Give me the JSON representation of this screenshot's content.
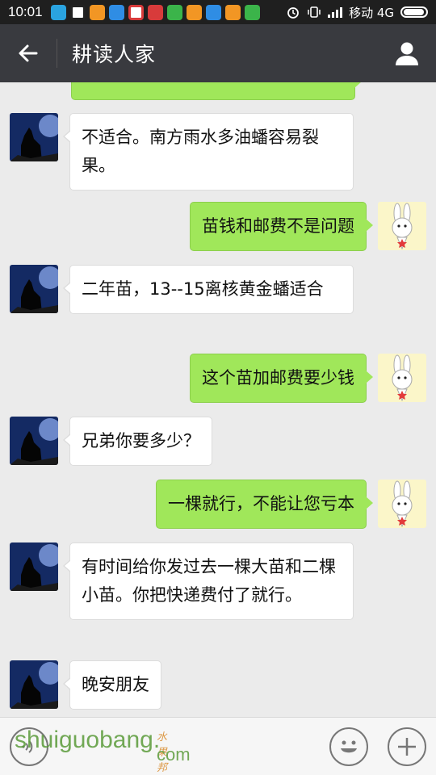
{
  "status_bar": {
    "time": "10:01",
    "carrier": "移动 4G",
    "notification_icons": [
      "message-icon",
      "qq-icon",
      "taobao-icon",
      "app-icon",
      "weibo-icon",
      "news-icon",
      "game-icon",
      "taobao-icon",
      "app-icon",
      "taobao-icon",
      "wechat-icon"
    ],
    "icon_colors": [
      "#2aa3e0",
      "#222222",
      "#f29624",
      "#2f8de4",
      "#d83b3b",
      "#d83b3b",
      "#3bb44a",
      "#f29624",
      "#2f8de4",
      "#f29624",
      "#3bb44a"
    ]
  },
  "header": {
    "title": "耕读人家"
  },
  "messages": [
    {
      "side": "out",
      "text": "",
      "avatar": "rabbit-avatar"
    },
    {
      "side": "in",
      "text": "不适合。南方雨水多油蟠容易裂果。",
      "avatar": "wolf-avatar"
    },
    {
      "side": "out",
      "text": "苗钱和邮费不是问题",
      "avatar": "rabbit-avatar"
    },
    {
      "side": "in",
      "text": "二年苗，13--15离核黄金蟠适合",
      "avatar": "wolf-avatar"
    },
    {
      "side": "out",
      "text": "这个苗加邮费要少钱",
      "avatar": "rabbit-avatar"
    },
    {
      "side": "in",
      "text": "兄弟你要多少？",
      "avatar": "wolf-avatar"
    },
    {
      "side": "out",
      "text": "一棵就行，不能让您亏本",
      "avatar": "rabbit-avatar"
    },
    {
      "side": "in",
      "text": "有时间给你发过去一棵大苗和二棵小苗。你把快递费付了就行。",
      "avatar": "wolf-avatar"
    },
    {
      "side": "in",
      "text": "晚安朋友",
      "avatar": "wolf-avatar"
    }
  ],
  "watermark": {
    "main": "shuiguobang.",
    "cn": "水果邦",
    "suffix": "com"
  },
  "input_bar": {
    "voice_icon": "voice-icon",
    "emoji_icon": "emoji-icon",
    "plus_icon": "plus-icon"
  },
  "colors": {
    "header_bg": "#393a3f",
    "chat_bg": "#ebebeb",
    "outgoing_bubble": "#a0e75a",
    "incoming_bubble": "#ffffff"
  }
}
